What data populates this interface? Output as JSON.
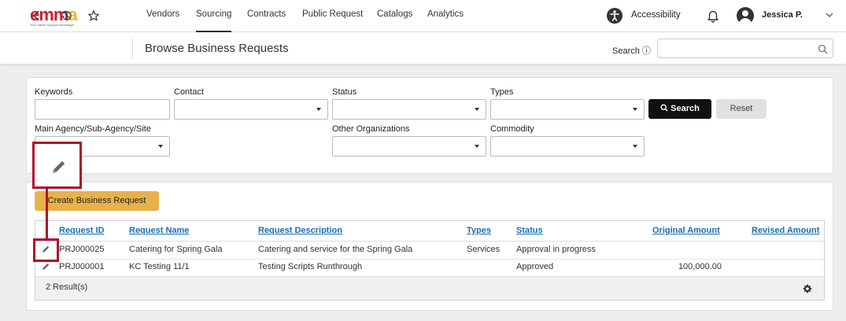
{
  "logo": {
    "text": "emma",
    "tagline": "Your Stable Support Advantage"
  },
  "nav": {
    "items": [
      {
        "label": "Vendors"
      },
      {
        "label": "Sourcing",
        "active": true
      },
      {
        "label": "Contracts"
      },
      {
        "label": "Public Request"
      },
      {
        "label": "Catalogs"
      },
      {
        "label": "Analytics"
      }
    ],
    "accessibility_label": "Accessibility",
    "user_name": "Jessica P."
  },
  "toolbar": {
    "page_title": "Browse Business Requests",
    "search_label": "Search ⓘ",
    "search_value": ""
  },
  "filters": {
    "keywords_label": "Keywords",
    "contact_label": "Contact",
    "status_label": "Status",
    "types_label": "Types",
    "agency_label": "Main Agency/Sub-Agency/Site",
    "other_org_label": "Other Organizations",
    "commodity_label": "Commodity",
    "search_button": "Search",
    "reset_button": "Reset"
  },
  "results": {
    "create_button": "Create Business Request",
    "columns": [
      "Request ID",
      "Request Name",
      "Request Description",
      "Types",
      "Status",
      "Original Amount",
      "Revised Amount"
    ],
    "rows": [
      {
        "id": "PRJ000025",
        "name": "Catering for Spring Gala",
        "description": "Catering and service for the Spring Gala",
        "types": "Services",
        "status": "Approval in progress",
        "original_amount": "",
        "revised_amount": ""
      },
      {
        "id": "PRJ000001",
        "name": "KC Testing 11/1",
        "description": "Testing Scripts Runthrough",
        "types": "",
        "status": "Approved",
        "original_amount": "100,000.00",
        "revised_amount": ""
      }
    ],
    "count_text": "2 Result(s)"
  },
  "colors": {
    "accent_link": "#1a6fb0",
    "create_button": "#e8b24a",
    "callout": "#b0102a",
    "search_button": "#111111"
  }
}
